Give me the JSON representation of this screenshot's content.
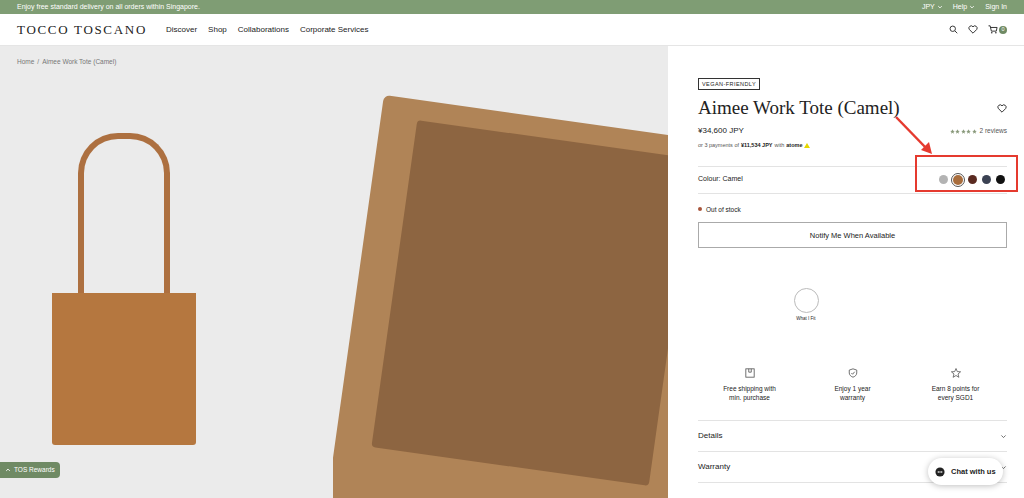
{
  "announcement": "Enjoy free standard delivery on all orders within Singapore.",
  "top_links": [
    {
      "label": "JPY",
      "dropdown": true
    },
    {
      "label": "Help",
      "dropdown": true
    },
    {
      "label": "Sign In",
      "dropdown": false
    }
  ],
  "logo": "TOCCO TOSCANO",
  "nav": [
    {
      "label": "Discover"
    },
    {
      "label": "Shop"
    },
    {
      "label": "Collaborations"
    },
    {
      "label": "Corporate Services"
    }
  ],
  "cart_count": "0",
  "breadcrumb": {
    "items": [
      "Home",
      "Aimee Work Tote (Camel)"
    ],
    "separator": "/"
  },
  "product": {
    "badge": "VEGAN-FRIENDLY",
    "title": "Aimee Work Tote (Camel)",
    "price": "¥34,600 JPY",
    "rating": {
      "stars": 5,
      "reviews": "2 reviews"
    },
    "installment": {
      "prefix": "or 3 payments of",
      "amount": "¥11,534 JPY",
      "suffix": "with",
      "provider": "atome"
    },
    "colour_label": "Colour: Camel",
    "swatches": [
      {
        "color": "#b3b3b3",
        "selected": false
      },
      {
        "color": "#a86d3d",
        "selected": true
      },
      {
        "color": "#5a2a20",
        "selected": false
      },
      {
        "color": "#3b4253",
        "selected": false
      },
      {
        "color": "#111111",
        "selected": false
      }
    ],
    "stock": "Out of stock",
    "notify_button": "Notify Me When Available",
    "fit_label": "What I Fit",
    "perks": [
      {
        "lines": [
          "Free shipping with",
          "min. purchase"
        ]
      },
      {
        "lines": [
          "Enjoy 1 year",
          "warranty"
        ]
      },
      {
        "lines": [
          "Earn 8 points for",
          "every SGD1"
        ]
      }
    ],
    "accordions": [
      {
        "label": "Details",
        "expanded": false
      },
      {
        "label": "Warranty",
        "expanded": false
      }
    ]
  },
  "rewards_button": "TOS Rewards",
  "chat_button": "Chat with us"
}
